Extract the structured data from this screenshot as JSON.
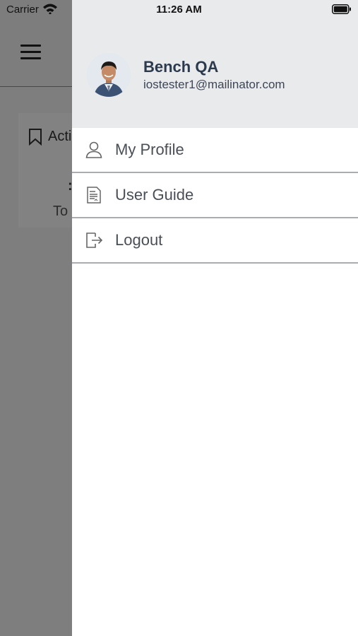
{
  "status_bar": {
    "carrier": "Carrier",
    "time": "11:26 AM"
  },
  "background": {
    "card_title": "Acti",
    "card_value": ":",
    "card_subtitle": "To"
  },
  "drawer": {
    "user": {
      "name": "Bench QA",
      "email": "iostester1@mailinator.com"
    },
    "items": [
      {
        "label": "My Profile",
        "icon": "person-icon"
      },
      {
        "label": "User Guide",
        "icon": "document-icon"
      },
      {
        "label": "Logout",
        "icon": "logout-icon"
      }
    ]
  },
  "colors": {
    "drawer_header_bg": "#e9eaec",
    "name_text": "#2c3a4e",
    "menu_text": "#4a4f57",
    "overlay": "#7a7a7a"
  }
}
